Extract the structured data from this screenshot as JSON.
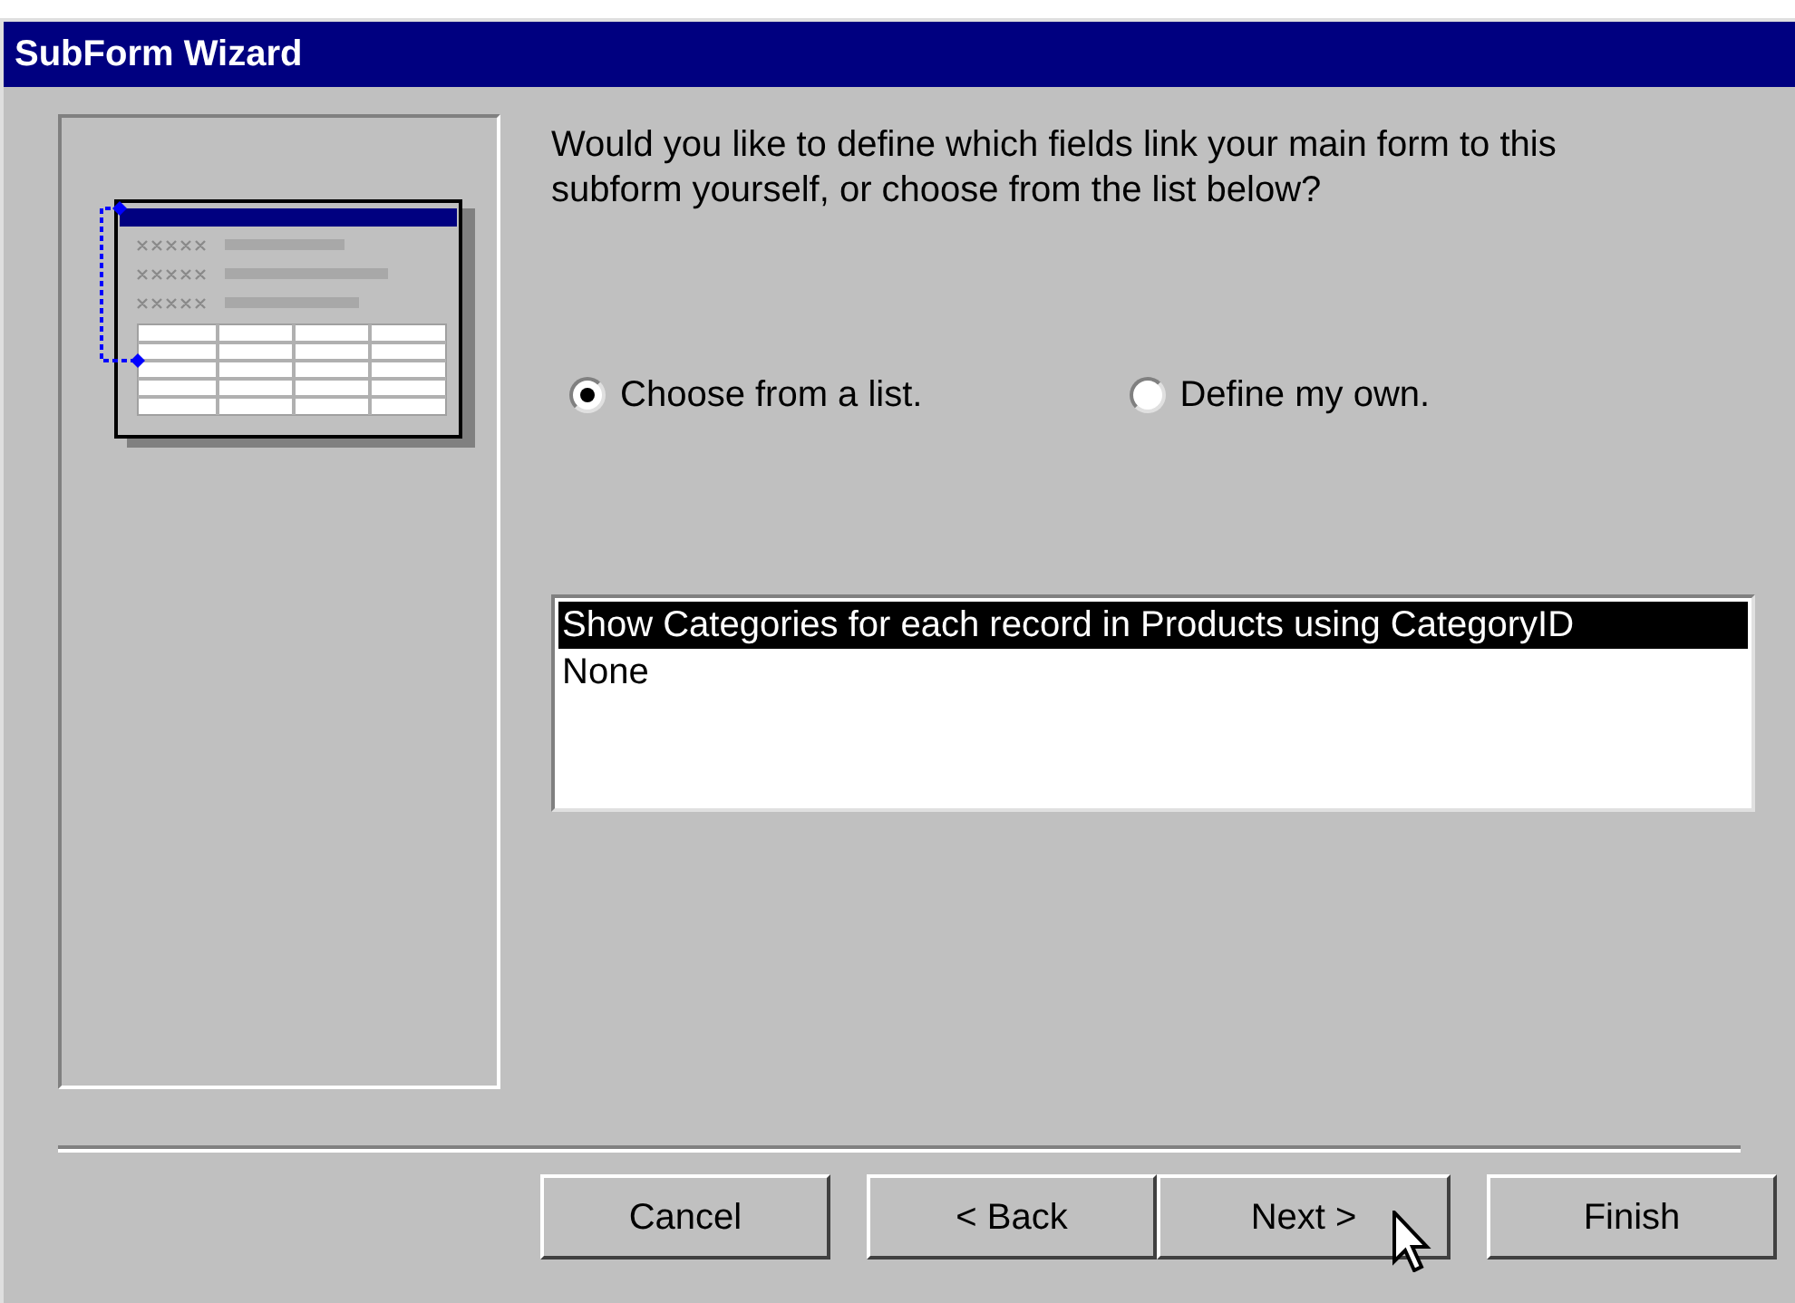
{
  "window": {
    "title": "SubForm Wizard"
  },
  "question": "Would you like to define which fields link your main form to this subform yourself, or choose from the list below?",
  "options": [
    {
      "label": "Choose from a list.",
      "selected": true
    },
    {
      "label": "Define my own.",
      "selected": false
    }
  ],
  "list": {
    "items": [
      {
        "label": "Show Categories for each record in Products using CategoryID",
        "selected": true
      },
      {
        "label": "None",
        "selected": false
      }
    ]
  },
  "buttons": [
    {
      "label": "Cancel",
      "kind": "single"
    },
    {
      "label": "< Back",
      "kind": "left"
    },
    {
      "label": "Next >",
      "kind": "right"
    },
    {
      "label": "Finish",
      "kind": "single"
    }
  ]
}
